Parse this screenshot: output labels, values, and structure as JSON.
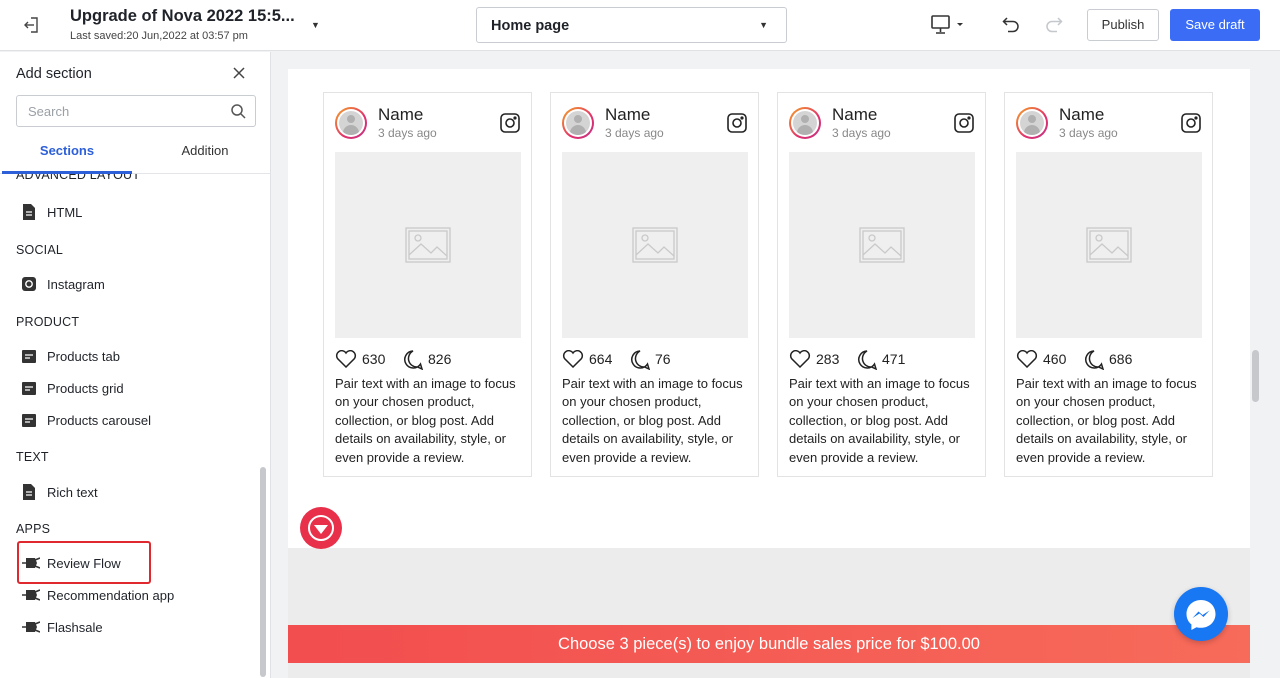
{
  "topbar": {
    "title": "Upgrade of Nova 2022 15:5...",
    "last_saved": "Last saved:20 Jun,2022 at 03:57 pm",
    "page_select": "Home page",
    "publish_label": "Publish",
    "save_label": "Save draft"
  },
  "sidebar": {
    "title": "Add section",
    "search_placeholder": "Search",
    "tabs": [
      {
        "label": "Sections",
        "active": true
      },
      {
        "label": "Addition",
        "active": false
      }
    ],
    "groups": [
      {
        "label": "ADVANCED LAYOUT",
        "items": [
          {
            "label": "HTML",
            "icon": "file-icon"
          }
        ]
      },
      {
        "label": "SOCIAL",
        "items": [
          {
            "label": "Instagram",
            "icon": "instagram-icon"
          }
        ]
      },
      {
        "label": "PRODUCT",
        "items": [
          {
            "label": "Products tab",
            "icon": "products-icon"
          },
          {
            "label": "Products grid",
            "icon": "products-icon"
          },
          {
            "label": "Products carousel",
            "icon": "products-icon"
          }
        ]
      },
      {
        "label": "TEXT",
        "items": [
          {
            "label": "Rich text",
            "icon": "file-icon"
          }
        ]
      },
      {
        "label": "APPS",
        "items": [
          {
            "label": "Review Flow",
            "icon": "plug-icon",
            "highlighted": true
          },
          {
            "label": "Recommendation app",
            "icon": "plug-icon"
          },
          {
            "label": "Flashsale",
            "icon": "plug-icon"
          }
        ]
      }
    ]
  },
  "cards": [
    {
      "name": "Name",
      "time": "3 days ago",
      "likes": "630",
      "comments": "826",
      "text": "Pair text with an image to focus on your chosen product, collection, or blog post. Add details on availability, style, or even provide a review."
    },
    {
      "name": "Name",
      "time": "3 days ago",
      "likes": "664",
      "comments": "76",
      "text": "Pair text with an image to focus on your chosen product, collection, or blog post. Add details on availability, style, or even provide a review."
    },
    {
      "name": "Name",
      "time": "3 days ago",
      "likes": "283",
      "comments": "471",
      "text": "Pair text with an image to focus on your chosen product, collection, or blog post. Add details on availability, style, or even provide a review."
    },
    {
      "name": "Name",
      "time": "3 days ago",
      "likes": "460",
      "comments": "686",
      "text": "Pair text with an image to focus on your chosen product, collection, or blog post. Add details on availability, style, or even provide a review."
    }
  ],
  "bundle_bar": "Choose 3 piece(s) to enjoy bundle sales price for $100.00",
  "colors": {
    "accent": "#3b6cf5",
    "tab_active": "#2d5fd8",
    "highlight": "#e0282f",
    "bundle_bar": "#f24d4f",
    "messenger": "#1877f2",
    "review_badge": "#e8304a"
  }
}
